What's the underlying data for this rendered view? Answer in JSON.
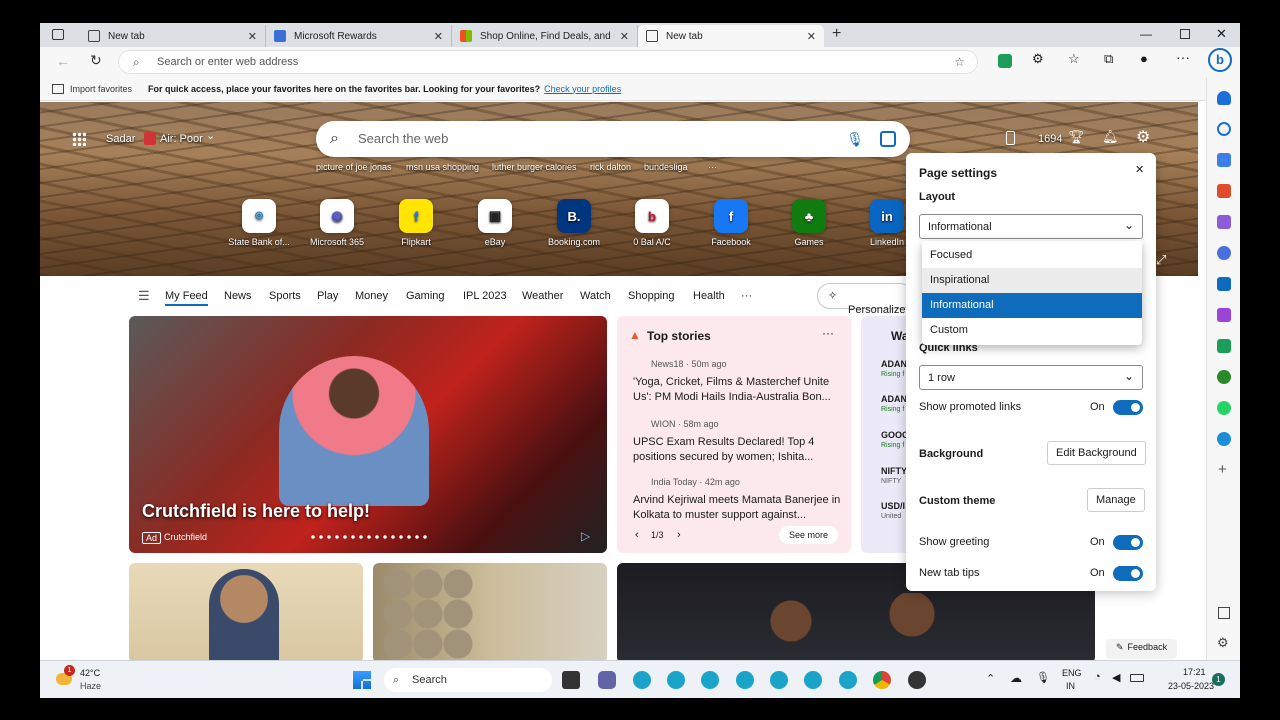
{
  "tabs": [
    {
      "label": "New tab"
    },
    {
      "label": "Microsoft Rewards"
    },
    {
      "label": "Shop Online, Find Deals, and Co"
    },
    {
      "label": "New tab"
    }
  ],
  "address": {
    "placeholder": "Search or enter web address"
  },
  "favbar": {
    "import": "Import favorites",
    "message": "For quick access, place your favorites here on the favorites bar. Looking for your favorites?",
    "link": "Check your profiles"
  },
  "hero": {
    "location": "Sadar",
    "air": "Air: Poor",
    "search_placeholder": "Search the web",
    "points": "1694",
    "suggestions": [
      "picture of joe jonas",
      "msn usa shopping",
      "luther burger calories",
      "rick dalton",
      "bundesliga"
    ],
    "quicklinks": [
      {
        "label": "State Bank of...",
        "glyph": "⌾",
        "color": "#1e7fc0"
      },
      {
        "label": "Microsoft 365",
        "glyph": "◉",
        "color": "#5b5fc7"
      },
      {
        "label": "Flipkart",
        "glyph": "f",
        "color": "#2874f0"
      },
      {
        "label": "eBay",
        "glyph": "▣",
        "color": "#222"
      },
      {
        "label": "Booking.com",
        "glyph": "B.",
        "color": "#003580"
      },
      {
        "label": "0 Bal A/C",
        "glyph": "b",
        "color": "#c8102e"
      },
      {
        "label": "Facebook",
        "glyph": "f",
        "color": "#1877f2"
      },
      {
        "label": "Games",
        "glyph": "♣",
        "color": "#107c10"
      },
      {
        "label": "LinkedIn",
        "glyph": "in",
        "color": "#0a66c2"
      }
    ]
  },
  "nav": {
    "items": [
      "My Feed",
      "News",
      "Sports",
      "Play",
      "Money",
      "Gaming",
      "IPL 2023",
      "Weather",
      "Watch",
      "Shopping",
      "Health"
    ],
    "more": "···",
    "personalize": "Personalize"
  },
  "feed": {
    "ad_title": "Crutchfield is here to help!",
    "ad_badge": "Ad",
    "ad_source": "Crutchfield",
    "top_stories": {
      "title": "Top stories",
      "page": "1/3",
      "see_more": "See more",
      "items": [
        {
          "source": "News18 · 50m ago",
          "headline": "'Yoga, Cricket, Films & Masterchef Unite Us': PM Modi Hails India-Australia Bon..."
        },
        {
          "source": "WION · 58m ago",
          "headline": "UPSC Exam Results Declared! Top 4 positions secured by women; Ishita..."
        },
        {
          "source": "India Today · 42m ago",
          "headline": "Arvind Kejriwal meets Mamata Banerjee in Kolkata to muster support against..."
        }
      ]
    },
    "watch": {
      "title": "Wa",
      "rows": [
        {
          "a": "ADAN",
          "b": "Rising f"
        },
        {
          "a": "ADAN",
          "b": "Rising f"
        },
        {
          "a": "GOOG",
          "b": "Rising f"
        },
        {
          "a": "NIFTY",
          "b": "NIFTY"
        },
        {
          "a": "USD/I",
          "b": "United"
        }
      ]
    }
  },
  "settings": {
    "title": "Page settings",
    "layout_label": "Layout",
    "layout_value": "Informational",
    "options": [
      "Focused",
      "Inspirational",
      "Informational",
      "Custom"
    ],
    "quick_links_label": "Quick links",
    "quick_links_value": "1 row",
    "promoted_label": "Show promoted links",
    "on": "On",
    "background_label": "Background",
    "edit_background": "Edit Background",
    "theme_label": "Custom theme",
    "manage": "Manage",
    "greeting_label": "Show greeting",
    "tips_label": "New tab tips"
  },
  "feedback": "Feedback",
  "taskbar": {
    "temp": "42°C",
    "weather": "Haze",
    "search": "Search",
    "lang1": "ENG",
    "lang2": "IN",
    "time": "17:21",
    "date": "23-05-2023",
    "notif": "1",
    "weather_badge": "1"
  }
}
